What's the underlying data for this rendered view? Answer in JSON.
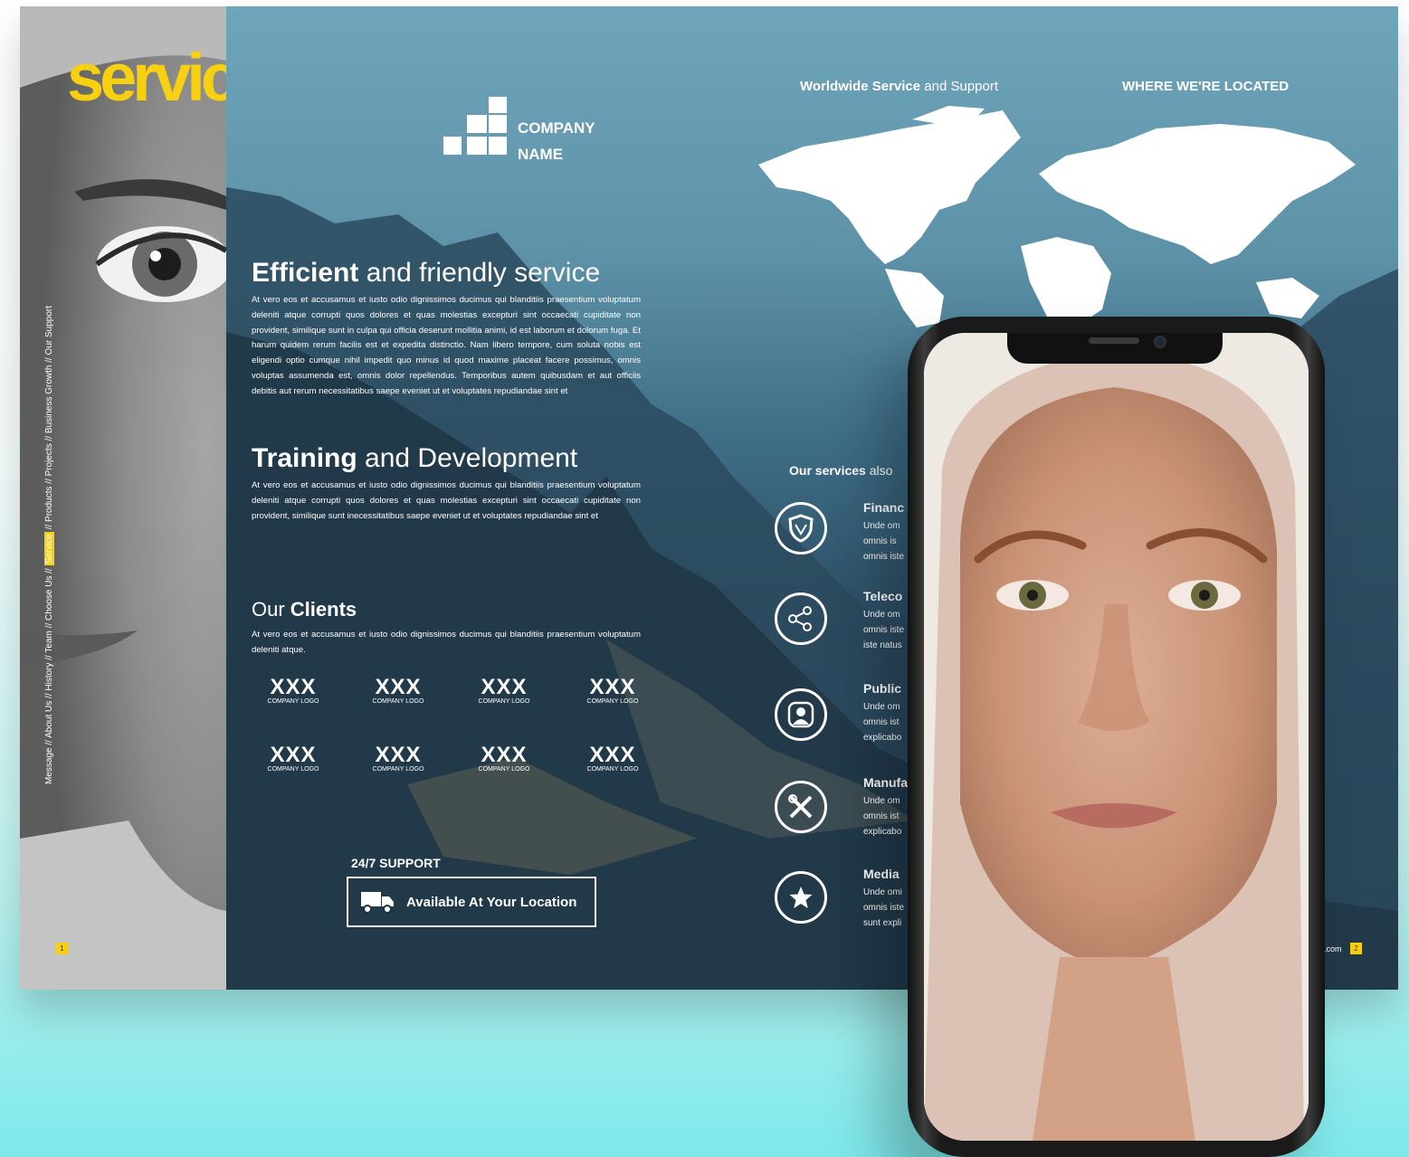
{
  "left_page": {
    "title": "service.",
    "nav": {
      "before": "Message // About Us // History // Team // Choose Us // ",
      "active": "Service",
      "after": " // Products // Projects // Business Growth // Our Support"
    },
    "page_number": "1"
  },
  "logo": {
    "line1": "COMPANY",
    "line2": "NAME"
  },
  "sections": {
    "efficient": {
      "bold": "Efficient",
      "rest": " and friendly service",
      "text": "At vero eos et accusamus et iusto odio dignissimos ducimus qui blanditiis praesentium voluptatum deleniti atque corrupti quos dolores et quas molestias excepturi sint occaecati cupiditate non provident, similique sunt in culpa qui officia deserunt mollitia animi, id est laborum et dolorum fuga. Et harum quidem rerum facilis est et expedita distinctio. Nam libero tempore, cum soluta nobis est eligendi optio cumque nihil impedit quo minus id quod maxime placeat facere possimus, omnis voluptas assumenda est, omnis dolor repellendus. Temporibus autem quibusdam et aut officiis debitis aut rerum necessitatibus saepe eveniet ut et voluptates repudiandae sint et"
    },
    "training": {
      "bold": "Training",
      "rest": " and Development",
      "text": "At vero eos et accusamus et iusto odio dignissimos ducimus qui blanditiis praesentium voluptatum deleniti atque corrupti quos dolores et quas molestias excepturi sint occaecati cupiditate non provident, similique sunt inecessitatibus saepe eveniet ut et voluptates repudiandae sint et"
    },
    "clients": {
      "light": "Our ",
      "bold": "Clients",
      "text": "At vero eos et accusamus et iusto odio dignissimos ducimus qui blanditiis praesentium voluptatum deleniti atque.",
      "logos": [
        {
          "big": "XXX",
          "small": "COMPANY LOGO"
        },
        {
          "big": "XXX",
          "small": "COMPANY LOGO"
        },
        {
          "big": "XXX",
          "small": "COMPANY LOGO"
        },
        {
          "big": "XXX",
          "small": "COMPANY LOGO"
        },
        {
          "big": "XXX",
          "small": "COMPANY LOGO"
        },
        {
          "big": "XXX",
          "small": "COMPANY LOGO"
        },
        {
          "big": "XXX",
          "small": "COMPANY LOGO"
        },
        {
          "big": "XXX",
          "small": "COMPANY LOGO"
        }
      ]
    }
  },
  "support": {
    "label": "24/7 SUPPORT",
    "button": "Available At Your Location"
  },
  "map": {
    "heading_bold": "Worldwide Service",
    "heading_rest": " and Support",
    "located": "WHERE WE'RE LOCATED"
  },
  "services": {
    "heading_bold": "Our services",
    "heading_rest": " also",
    "items": [
      {
        "icon": "shield-icon",
        "title": "Financ",
        "lines": [
          "Unde om",
          "omnis is",
          "omnis iste"
        ]
      },
      {
        "icon": "share-icon",
        "title": "Teleco",
        "lines": [
          "Unde om",
          "omnis iste",
          "iste natus"
        ]
      },
      {
        "icon": "person-icon",
        "title": "Public",
        "lines": [
          "Unde om",
          "omnis ist",
          "explicabo"
        ]
      },
      {
        "icon": "tools-icon",
        "title": "Manufa",
        "lines": [
          "Unde om",
          "omnis ist",
          "explicabo"
        ]
      },
      {
        "icon": "star-icon",
        "title": "Media",
        "lines": [
          "Unde omi",
          "omnis iste",
          "sunt expli"
        ]
      }
    ]
  },
  "footer": {
    "domain": ".com",
    "page_number": "2"
  },
  "colors": {
    "accent": "#f7d10f",
    "page_blue": "#5d92a8",
    "page_dark": "#1c3346"
  }
}
